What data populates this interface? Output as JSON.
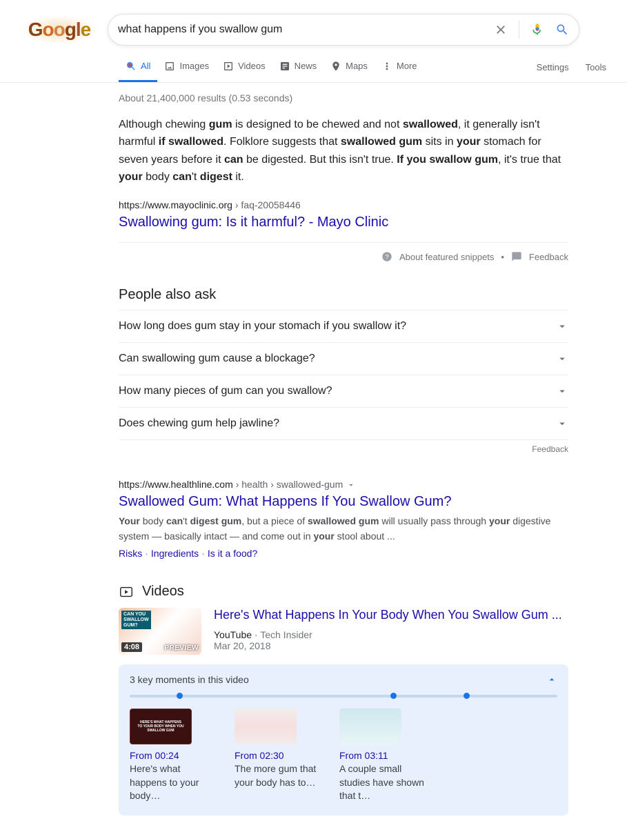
{
  "logo_text": "Google",
  "search": {
    "value": "what happens if you swallow gum"
  },
  "tabs": {
    "all": "All",
    "images": "Images",
    "videos": "Videos",
    "news": "News",
    "maps": "Maps",
    "more": "More"
  },
  "settings": "Settings",
  "tools": "Tools",
  "stats": "About 21,400,000 results (0.53 seconds)",
  "featured": {
    "snippet_html": "Although chewing <b>gum</b> is designed to be chewed and not <b>swallowed</b>, it generally isn't harmful <b>if swallowed</b>. Folklore suggests that <b>swallowed gum</b> sits in <b>your</b> stomach for seven years before it <b>can</b> be digested. But this isn't true. <b>If you swallow gum</b>, it's true that <b>your</b> body <b>can</b>'t <b>digest</b> it.",
    "url": "https://www.mayoclinic.org",
    "crumb": " › faq-20058446",
    "title": "Swallowing gum: Is it harmful? - Mayo Clinic",
    "about": "About featured snippets",
    "feedback": "Feedback"
  },
  "paa": {
    "title": "People also ask",
    "items": [
      "How long does gum stay in your stomach if you swallow it?",
      "Can swallowing gum cause a blockage?",
      "How many pieces of gum can you swallow?",
      "Does chewing gum help jawline?"
    ],
    "feedback": "Feedback"
  },
  "result2": {
    "url": "https://www.healthline.com",
    "crumb": " › health › swallowed-gum",
    "title": "Swallowed Gum: What Happens If You Swallow Gum?",
    "desc_html": "<b>Your</b> body <b>can</b>'t <b>digest gum</b>, but a piece of <b>swallowed gum</b> will usually pass through <b>your</b> digestive system — basically intact — and come out in <b>your</b> stool about ...",
    "sitelinks": [
      "Risks",
      "Ingredients",
      "Is it a food?"
    ]
  },
  "videos": {
    "heading": "Videos",
    "thumb_banner": "CAN YOU\nSWALLOW\nGUM?",
    "title": "Here's What Happens In Your Body When You Swallow Gum ...",
    "source": "YouTube",
    "by": "Tech Insider",
    "date": "Mar 20, 2018",
    "duration": "4:08",
    "preview": "PREVIEW",
    "moments": {
      "heading": "3 key moments in this video",
      "dot_positions": [
        11,
        61,
        78
      ],
      "items": [
        {
          "time": "From 00:24",
          "desc": "Here's what happens to your body…",
          "thumb_label": "HERE'S WHAT HAPPENS\nTO YOUR BODY WHEN YOU\nSWALLOW GUM",
          "thumb_css": "background:#3a1010; color:#fff; font-size:5px; display:flex; align-items:center; justify-content:center; text-align:center; padding:4px; line-height:1.2; font-weight:bold; border:1px solid #6b2a2a;"
        },
        {
          "time": "From 02:30",
          "desc": "The more gum that your body has to…",
          "thumb_css": "background:linear-gradient(180deg,#f2ecec 0%,#f6dede 50%,#f2ecec 100%);"
        },
        {
          "time": "From 03:11",
          "desc": "A couple small studies have shown that t…",
          "thumb_css": "background:linear-gradient(180deg,#cfe8ef 0%, #e8f4f7 100%); position:relative;"
        }
      ]
    }
  }
}
